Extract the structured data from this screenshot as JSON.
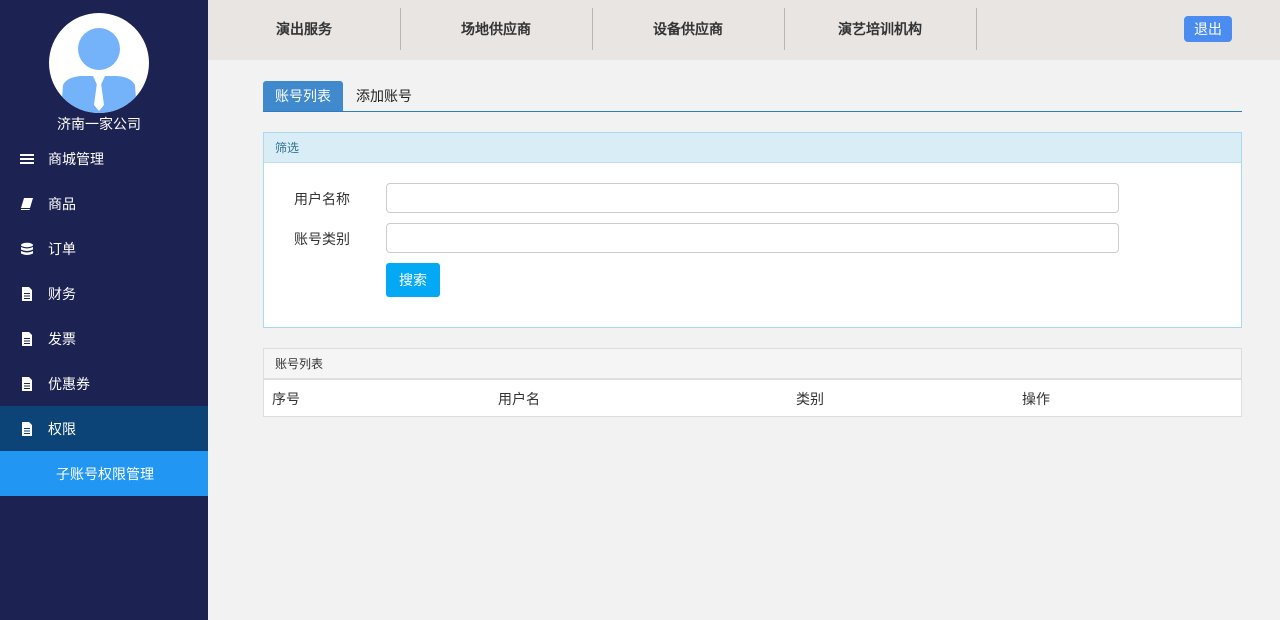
{
  "sidebar": {
    "company": "济南一家公司",
    "items": [
      {
        "label": "商城管理",
        "icon": "list-icon"
      },
      {
        "label": "商品",
        "icon": "book-icon"
      },
      {
        "label": "订单",
        "icon": "database-icon"
      },
      {
        "label": "财务",
        "icon": "document-icon"
      },
      {
        "label": "发票",
        "icon": "document-icon"
      },
      {
        "label": "优惠券",
        "icon": "document-icon"
      },
      {
        "label": "权限",
        "icon": "document-icon"
      }
    ],
    "sub_item": "子账号权限管理"
  },
  "topnav": {
    "items": [
      "演出服务",
      "场地供应商",
      "设备供应商",
      "演艺培训机构"
    ],
    "logout": "退出"
  },
  "tabs": {
    "active": "账号列表",
    "add": "添加账号"
  },
  "filter": {
    "title": "筛选",
    "username_label": "用户名称",
    "username_value": "",
    "type_label": "账号类别",
    "type_value": "",
    "search_button": "搜索"
  },
  "list": {
    "title": "账号列表",
    "columns": [
      "序号",
      "用户名",
      "类别",
      "操作"
    ]
  },
  "colors": {
    "sidebar_bg": "#1c2251",
    "active_menu": "#0c4477",
    "sub_menu": "#2196f3",
    "tab_active": "#3f89cc",
    "search_btn": "#03a9f4",
    "logout_btn": "#4a8cf0"
  }
}
